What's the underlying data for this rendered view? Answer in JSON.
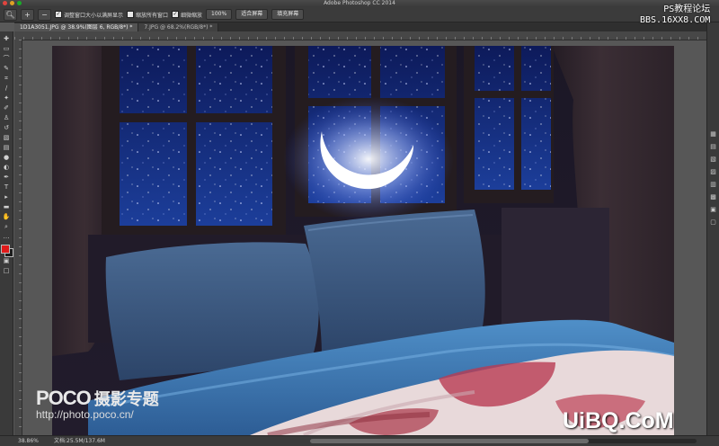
{
  "window": {
    "title": "Adobe Photoshop CC 2014"
  },
  "options_bar": {
    "checkbox1_label": "调整窗口大小以满屏显示",
    "checkbox2_label": "缩放所有窗口",
    "checkbox3_label": "细微缩放",
    "btn_100": "100%",
    "btn_fit": "适合屏幕",
    "btn_fill": "填充屏幕"
  },
  "tabs": [
    {
      "label": "1D1A3051.JPG @ 38.9%(图层 6, RGB/8*) *",
      "active": true
    },
    {
      "label": "7.JPG @ 68.2%(RGB/8*) *",
      "active": false
    }
  ],
  "status": {
    "zoom": "38.86%",
    "doc": "文档:25.5M/137.6M"
  },
  "watermarks": {
    "top_line1": "PS教程论坛",
    "top_line2": "BBS.16XX8.COM",
    "poco_brand": "POCO",
    "poco_sub": "摄影专题",
    "poco_url": "http://photo.poco.cn/",
    "uibq": "UiBQ.CoM"
  },
  "colors": {
    "foreground": "#e01a1a",
    "background": "#1c1c1c"
  }
}
